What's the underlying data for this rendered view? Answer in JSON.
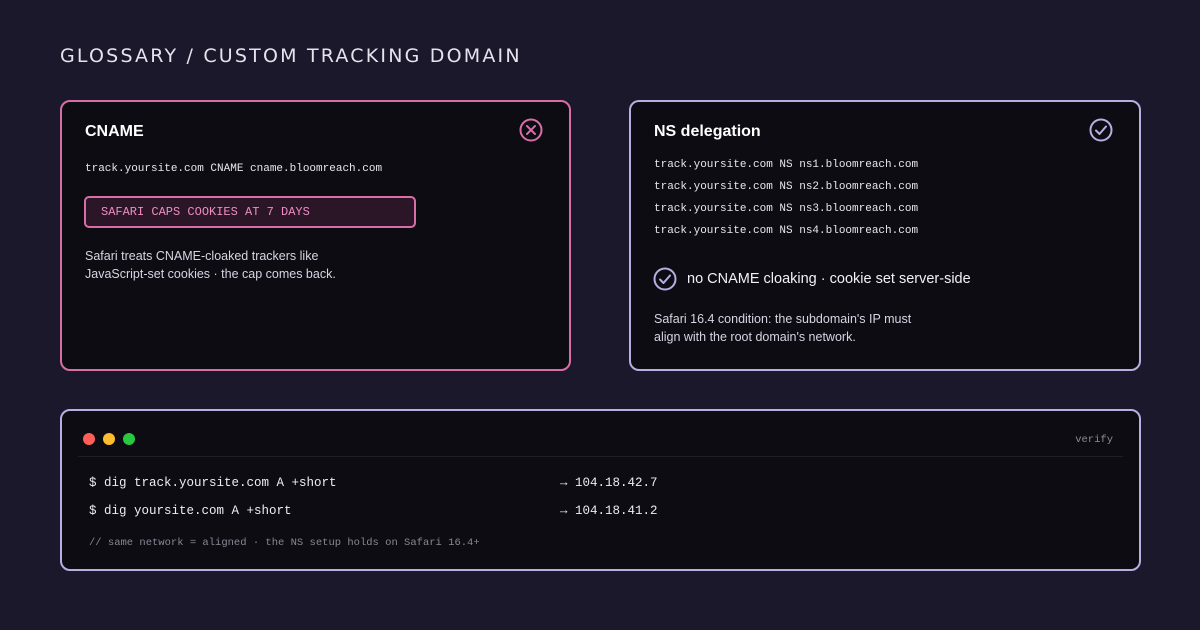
{
  "page": {
    "title": "GLOSSARY / CUSTOM TRACKING DOMAIN"
  },
  "cname_card": {
    "title": "CNAME",
    "status_icon": "x-circle-icon",
    "record": "track.yoursite.com CNAME cname.bloomreach.com",
    "warning": "SAFARI CAPS COOKIES AT 7 DAYS",
    "description_line1": "Safari treats CNAME-cloaked trackers like",
    "description_line2": "JavaScript-set cookies · the cap comes back.",
    "accent_color": "#d76fa6"
  },
  "ns_card": {
    "title": "NS delegation",
    "status_icon": "check-circle-icon",
    "records": [
      "track.yoursite.com NS ns1.bloomreach.com",
      "track.yoursite.com NS ns2.bloomreach.com",
      "track.yoursite.com NS ns3.bloomreach.com",
      "track.yoursite.com NS ns4.bloomreach.com"
    ],
    "check_label": "no CNAME cloaking · cookie set server-side",
    "description_line1": "Safari 16.4 condition: the subdomain's IP must",
    "description_line2": "align with the root domain's network.",
    "accent_color": "#b8aee2"
  },
  "terminal": {
    "tag": "verify",
    "window_dots": [
      "#ff5f57",
      "#febc2e",
      "#28c840"
    ],
    "commands": [
      {
        "cmd": "$ dig track.yoursite.com A +short",
        "result": "→ 104.18.42.7"
      },
      {
        "cmd": "$ dig yoursite.com A +short",
        "result": "→ 104.18.41.2"
      }
    ],
    "comment": "// same network = aligned · the NS setup holds on Safari 16.4+"
  }
}
